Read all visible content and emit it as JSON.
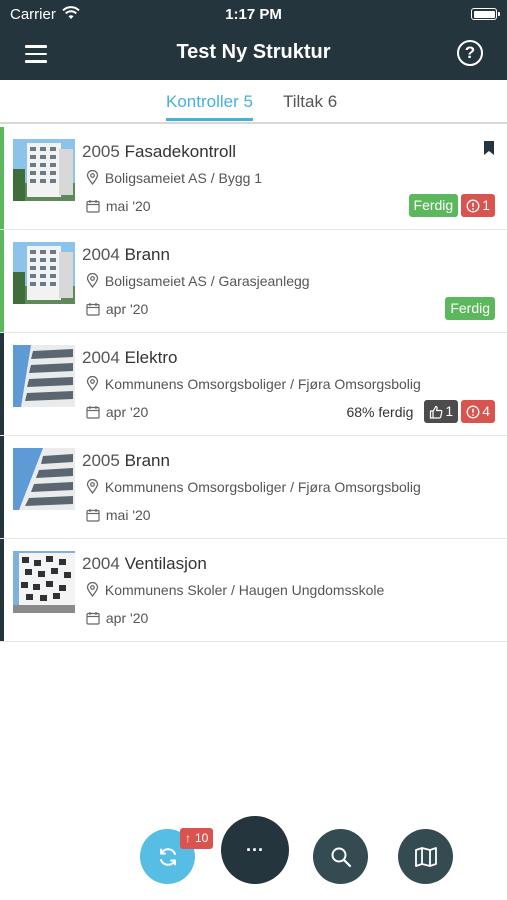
{
  "status_bar": {
    "carrier": "Carrier",
    "time": "1:17 PM"
  },
  "header": {
    "title": "Test Ny Struktur",
    "help_label": "?"
  },
  "tabs": [
    {
      "label": "Kontroller 5",
      "active": true
    },
    {
      "label": "Tiltak 6",
      "active": false
    }
  ],
  "items": [
    {
      "year": "2005",
      "name": "Fasadekontroll",
      "location": "Boligsameiet AS / Bygg 1",
      "date": "mai '20",
      "status_color": "#5cb85c",
      "bookmarked": true,
      "progress_text": "",
      "likes": "",
      "status_label": "Ferdig",
      "issues": "1"
    },
    {
      "year": "2004",
      "name": "Brann",
      "location": "Boligsameiet AS / Garasjeanlegg",
      "date": "apr '20",
      "status_color": "#5cb85c",
      "bookmarked": false,
      "progress_text": "",
      "likes": "",
      "status_label": "Ferdig",
      "issues": ""
    },
    {
      "year": "2004",
      "name": "Elektro",
      "location": "Kommunens Omsorgsboliger / Fjøra Omsorgsbolig",
      "date": "apr '20",
      "status_color": "#25353d",
      "bookmarked": false,
      "progress_text": "68% ferdig",
      "likes": "1",
      "status_label": "",
      "issues": "4"
    },
    {
      "year": "2005",
      "name": "Brann",
      "location": "Kommunens Omsorgsboliger / Fjøra Omsorgsbolig",
      "date": "mai '20",
      "status_color": "#25353d",
      "bookmarked": false,
      "progress_text": "",
      "likes": "",
      "status_label": "",
      "issues": ""
    },
    {
      "year": "2004",
      "name": "Ventilasjon",
      "location": "Kommunens Skoler / Haugen Ungdomsskole",
      "date": "apr '20",
      "status_color": "#25353d",
      "bookmarked": false,
      "progress_text": "",
      "likes": "",
      "status_label": "",
      "issues": ""
    }
  ],
  "bottom_actions": {
    "upload_count": "10",
    "more_label": "···",
    "icons": [
      "sync-icon",
      "more-icon",
      "search-icon",
      "map-icon"
    ]
  },
  "colors": {
    "header_bg": "#25353d",
    "accent": "#46b1d9",
    "done_green": "#5cb85c",
    "alert_red": "#d9534f"
  }
}
